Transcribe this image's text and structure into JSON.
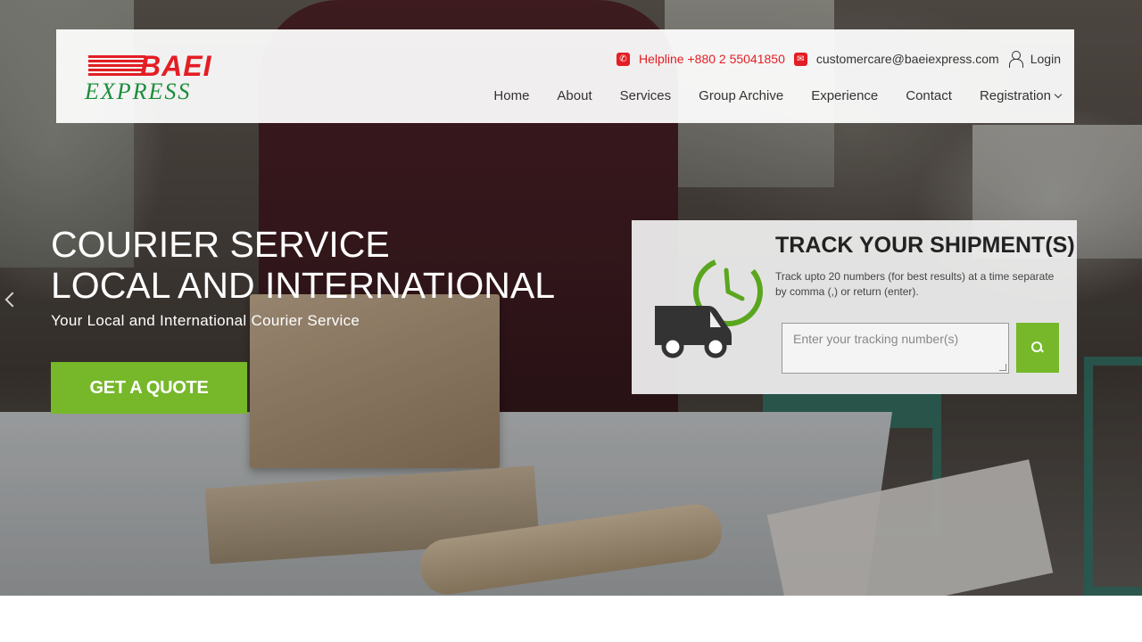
{
  "brand": {
    "name_top": "BAEI",
    "name_bottom": "EXPRESS",
    "red": "#e31e24",
    "green": "#1b8e3a"
  },
  "topbar": {
    "phone_icon": "phone-icon",
    "helpline": "Helpline +880 2 55041850",
    "mail_icon": "mail-icon",
    "email": "customercare@baeiexpress.com",
    "user_icon": "user-icon",
    "login": "Login"
  },
  "nav": {
    "items": [
      "Home",
      "About",
      "Services",
      "Group Archive",
      "Experience",
      "Contact",
      "Registration"
    ]
  },
  "hero": {
    "title_line1": "COURIER SERVICE",
    "title_line2": "LOCAL AND INTERNATIONAL",
    "subtitle": "Your Local and International Courier Service",
    "cta": "GET A QUOTE",
    "accent": "#76b82a"
  },
  "tracking": {
    "title": "TRACK YOUR SHIPMENT(S)",
    "description": "Track upto 20 numbers (for best results) at a time separate by comma (,) or return (enter).",
    "placeholder": "Enter your tracking number(s)",
    "search_icon": "search-icon"
  },
  "carousel": {
    "prev_icon": "chevron-left-icon",
    "next_icon": "chevron-right-icon"
  }
}
